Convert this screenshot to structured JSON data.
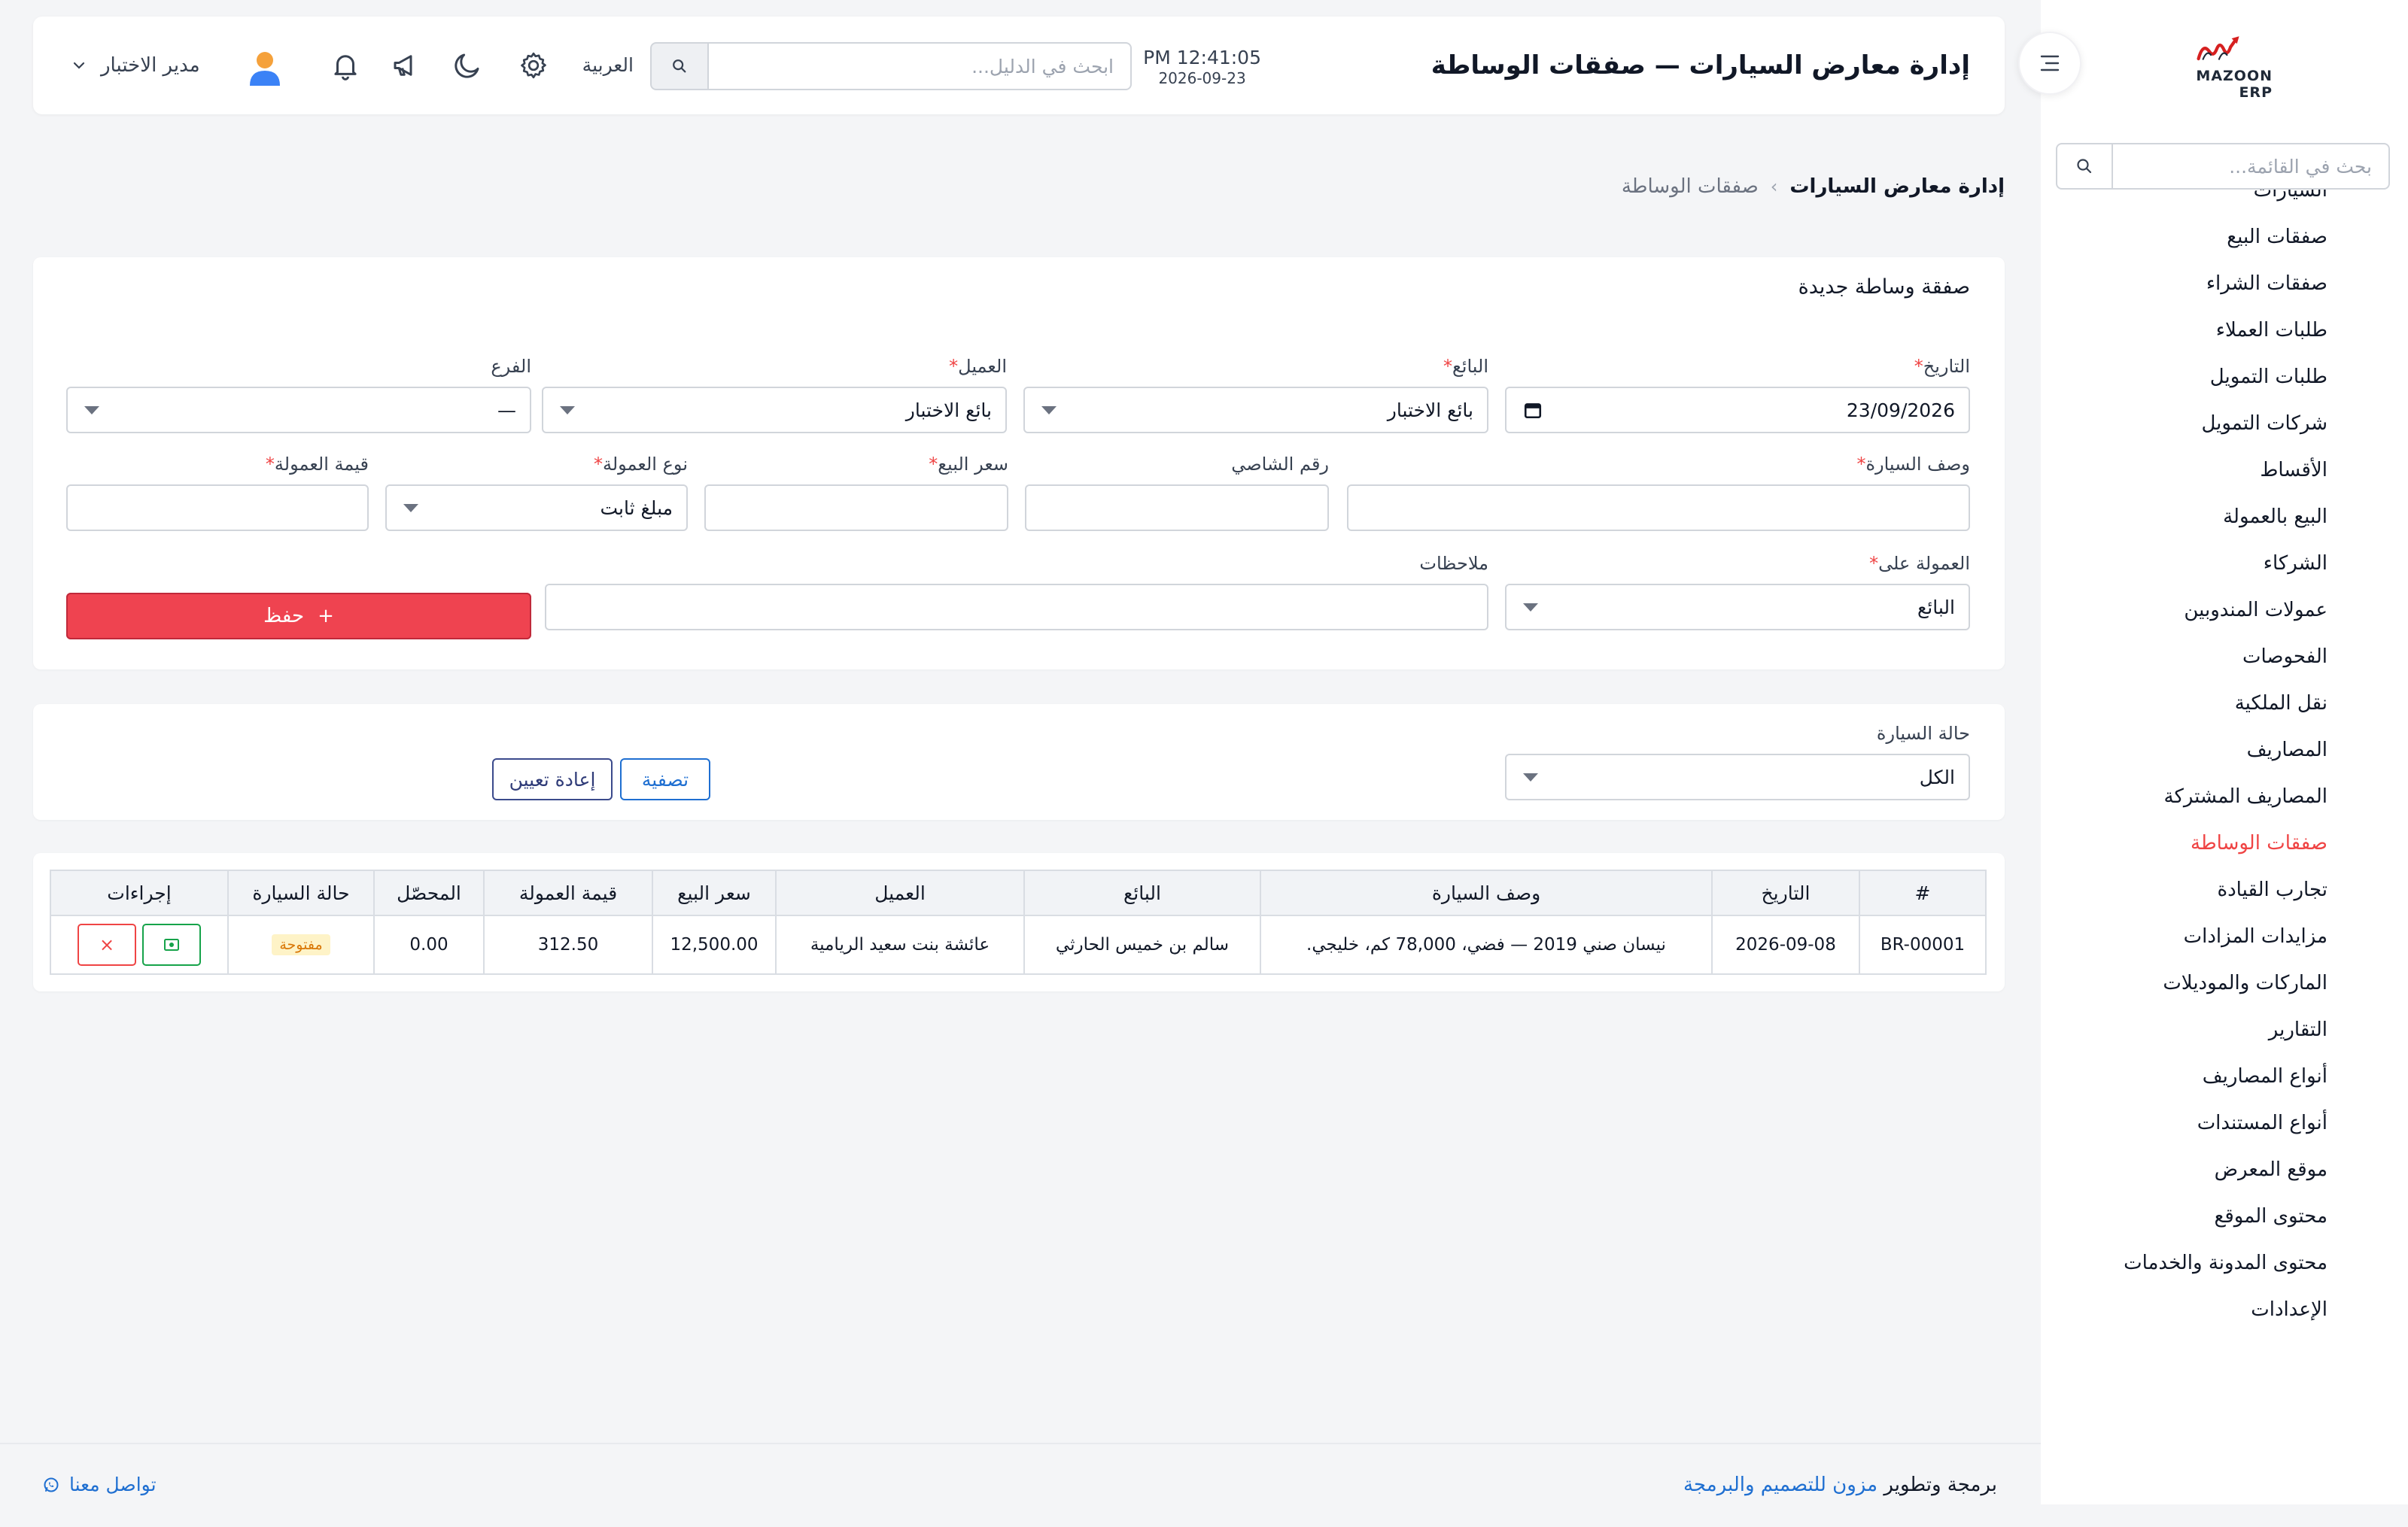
{
  "app": {
    "logo_text": "MAZOON ERP",
    "page_title": "إدارة معارض السيارات — صفقات الوساطة"
  },
  "header": {
    "time": "PM 12:41:05",
    "date": "2026-09-23",
    "guide_search_placeholder": "ابحث في الدليل...",
    "language": "العربية",
    "user_name": "مدير الاختبار"
  },
  "sidebar": {
    "search_placeholder": "بحث في القائمة...",
    "items": [
      {
        "label": "السيارات"
      },
      {
        "label": "صفقات البيع"
      },
      {
        "label": "صفقات الشراء"
      },
      {
        "label": "طلبات العملاء"
      },
      {
        "label": "طلبات التمويل"
      },
      {
        "label": "شركات التمويل"
      },
      {
        "label": "الأقساط"
      },
      {
        "label": "البيع بالعمولة"
      },
      {
        "label": "الشركاء"
      },
      {
        "label": "عمولات المندوبين"
      },
      {
        "label": "الفحوصات"
      },
      {
        "label": "نقل الملكية"
      },
      {
        "label": "المصاريف"
      },
      {
        "label": "المصاريف المشتركة"
      },
      {
        "label": "صفقات الوساطة"
      },
      {
        "label": "تجارب القيادة"
      },
      {
        "label": "مزايدات المزادات"
      },
      {
        "label": "الماركات والموديلات"
      },
      {
        "label": "التقارير"
      },
      {
        "label": "أنواع المصاريف"
      },
      {
        "label": "أنواع المستندات"
      },
      {
        "label": "موقع المعرض"
      },
      {
        "label": "محتوى الموقع"
      },
      {
        "label": "محتوى المدونة والخدمات"
      },
      {
        "label": "الإعدادات"
      }
    ],
    "active_index": 14
  },
  "breadcrumb": {
    "root": "إدارة معارض السيارات",
    "separator": "›",
    "current": "صفقات الوساطة"
  },
  "form": {
    "title": "صفقة وساطة جديدة",
    "date_label": "التاريخ",
    "date_value": "23/09/2026",
    "seller_label": "البائع",
    "seller_value": "بائع الاختبار",
    "client_label": "العميل",
    "client_value": "بائع الاختبار",
    "branch_label": "الفرع",
    "branch_value": "—",
    "car_desc_label": "وصف السيارة",
    "chassis_label": "رقم الشاصي",
    "sale_price_label": "سعر البيع",
    "commission_type_label": "نوع العمولة",
    "commission_type_value": "مبلغ ثابت",
    "commission_value_label": "قيمة العمولة",
    "commission_on_label": "العمولة على",
    "commission_on_value": "البائع",
    "notes_label": "ملاحظات",
    "required_mark": "*",
    "save_label": "حفظ",
    "save_icon": "+"
  },
  "filter": {
    "status_label": "حالة السيارة",
    "status_value": "الكل",
    "filter_label": "تصفية",
    "reset_label": "إعادة تعيين"
  },
  "table": {
    "columns": [
      "#",
      "التاريخ",
      "وصف السيارة",
      "البائع",
      "العميل",
      "سعر البيع",
      "قيمة العمولة",
      "المحصّل",
      "حالة السيارة",
      "إجراءات"
    ],
    "rows": [
      {
        "id": "BR-00001",
        "date": "2026-09-08",
        "car": "نيسان صني 2019 — فضي، 78,000 كم، خليجي.",
        "seller": "سالم بن خميس الحارثي",
        "client": "عائشة بنت سعيد الريامية",
        "sale_price": "12,500.00",
        "commission": "312.50",
        "collected": "0.00",
        "status": "مفتوحة",
        "delete_icon": "×"
      }
    ]
  },
  "footer": {
    "contact": "تواصل معنا",
    "credit_prefix": "برمجة وتطوير",
    "credit_link": "مزون للتصميم والبرمجة"
  },
  "colors": {
    "accent_red": "#ef4350",
    "link_blue": "#1f6fd1",
    "success_green": "#16a34a",
    "warning_amber": "#d97706"
  }
}
